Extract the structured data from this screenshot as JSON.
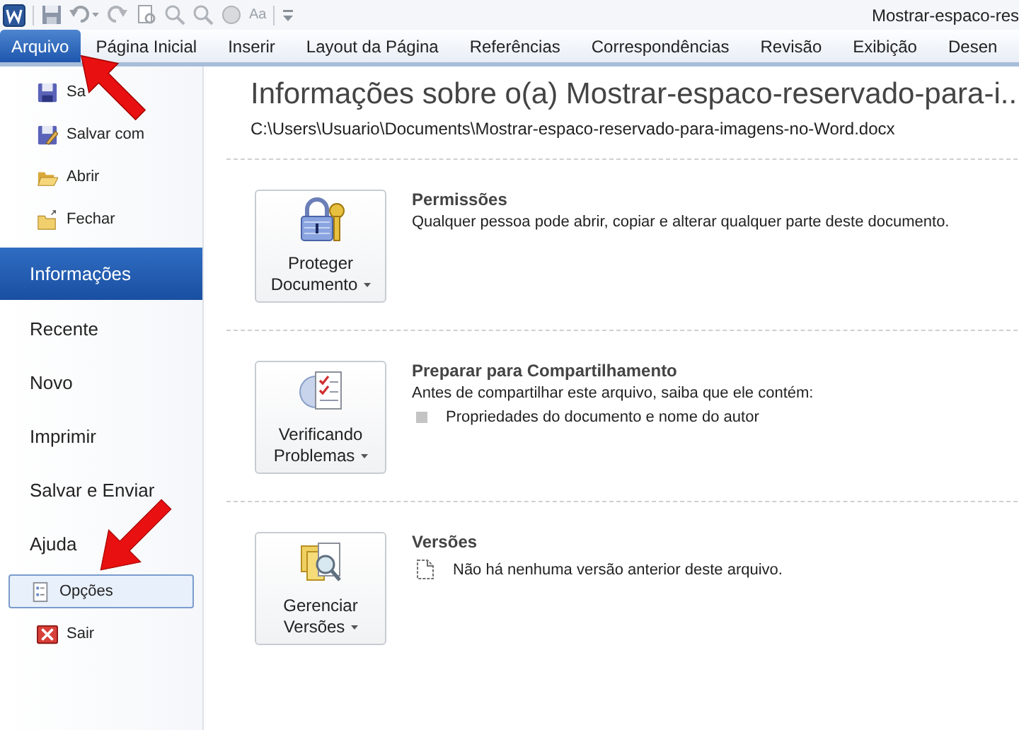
{
  "window": {
    "title": "Mostrar-espaco-res"
  },
  "quick_access": {
    "font_label": "Aa"
  },
  "tabs": [
    {
      "label": "Arquivo",
      "selected": true
    },
    {
      "label": "Página Inicial",
      "selected": false
    },
    {
      "label": "Inserir",
      "selected": false
    },
    {
      "label": "Layout da Página",
      "selected": false
    },
    {
      "label": "Referências",
      "selected": false
    },
    {
      "label": "Correspondências",
      "selected": false
    },
    {
      "label": "Revisão",
      "selected": false
    },
    {
      "label": "Exibição",
      "selected": false
    },
    {
      "label": "Desen",
      "selected": false
    }
  ],
  "sidebar": {
    "items": [
      {
        "label": "Sa",
        "kind": "save",
        "selected": false,
        "highlighted": false
      },
      {
        "label": "Salvar com",
        "kind": "save-as",
        "selected": false,
        "highlighted": false
      },
      {
        "label": "Abrir",
        "kind": "open",
        "selected": false,
        "highlighted": false
      },
      {
        "label": "Fechar",
        "kind": "close",
        "selected": false,
        "highlighted": false
      },
      {
        "label": "Informações",
        "kind": "page",
        "selected": true,
        "highlighted": false
      },
      {
        "label": "Recente",
        "kind": "page",
        "selected": false,
        "highlighted": false
      },
      {
        "label": "Novo",
        "kind": "page",
        "selected": false,
        "highlighted": false
      },
      {
        "label": "Imprimir",
        "kind": "page",
        "selected": false,
        "highlighted": false
      },
      {
        "label": "Salvar e Enviar",
        "kind": "page",
        "selected": false,
        "highlighted": false
      },
      {
        "label": "Ajuda",
        "kind": "page",
        "selected": false,
        "highlighted": false
      },
      {
        "label": "Opções",
        "kind": "options",
        "selected": false,
        "highlighted": true
      },
      {
        "label": "Sair",
        "kind": "exit",
        "selected": false,
        "highlighted": false
      }
    ]
  },
  "info": {
    "title": "Informações sobre o(a) Mostrar-espaco-reservado-para-i...",
    "path": "C:\\Users\\Usuario\\Documents\\Mostrar-espaco-reservado-para-imagens-no-Word.docx",
    "sections": [
      {
        "kind": "protect",
        "button": [
          "Proteger",
          "Documento"
        ],
        "heading": "Permissões",
        "text": "Qualquer pessoa pode abrir, copiar e alterar qualquer parte deste documento."
      },
      {
        "kind": "inspect",
        "button": [
          "Verificando",
          "Problemas"
        ],
        "heading": "Preparar para Compartilhamento",
        "text": "Antes de compartilhar este arquivo, saiba que ele contém:",
        "bullets": [
          {
            "kind": "square",
            "text": "Propriedades do documento e nome do autor"
          }
        ]
      },
      {
        "kind": "versions",
        "button": [
          "Gerenciar",
          "Versões"
        ],
        "heading": "Versões",
        "bullets": [
          {
            "kind": "page",
            "text": "Não há nenhuma versão anterior deste arquivo."
          }
        ]
      }
    ]
  }
}
